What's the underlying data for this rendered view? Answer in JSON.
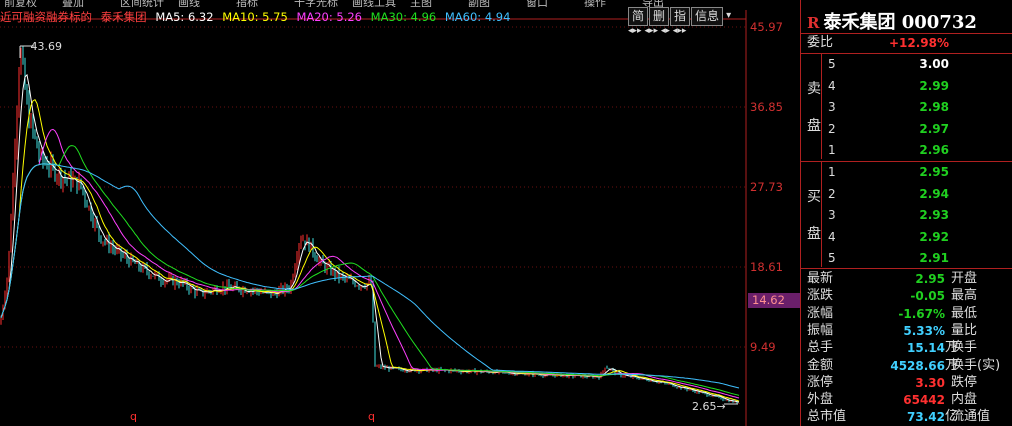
{
  "menu": [
    "前复权",
    "叠加",
    "区间统计",
    "画线",
    "指标",
    "十字光标",
    "画线工具",
    "主图",
    "副图",
    "窗口",
    "操作",
    "导出"
  ],
  "info_bar": {
    "prefix": "近可融资融券标的",
    "name": "泰禾集团",
    "ma5": "MA5: 6.32",
    "ma10": "MA10: 5.75",
    "ma20": "MA20: 5.26",
    "ma30": "MA30: 4.96",
    "ma60": "MA60: 4.94"
  },
  "toolbar": {
    "jian": "简",
    "shan": "删",
    "zhi": "指",
    "xinxi": "信息",
    "arrow": "▾"
  },
  "axis": {
    "labels": [
      "45.97",
      "36.85",
      "27.73",
      "18.61",
      "9.49"
    ],
    "current": "14.62"
  },
  "chart": {
    "high_label": "43.69",
    "low_label": "2.65",
    "q_marker": "q"
  },
  "colors": {
    "up": "#ff3030",
    "down": "#20d020",
    "ma5": "#ffffff",
    "ma10": "#ffff00",
    "ma20": "#ff40ff",
    "ma30": "#20e020",
    "ma60": "#40c0ff"
  },
  "panel": {
    "title": "泰禾集团",
    "code": "000732",
    "weibi_label": "委比",
    "weibi_value": "+12.98%",
    "sell_label": [
      "卖",
      "盘"
    ],
    "buy_label": [
      "买",
      "盘"
    ],
    "asks": [
      {
        "level": "5",
        "price": "3.00"
      },
      {
        "level": "4",
        "price": "2.99"
      },
      {
        "level": "3",
        "price": "2.98"
      },
      {
        "level": "2",
        "price": "2.97"
      },
      {
        "level": "1",
        "price": "2.96"
      }
    ],
    "bids": [
      {
        "level": "1",
        "price": "2.95"
      },
      {
        "level": "2",
        "price": "2.94"
      },
      {
        "level": "3",
        "price": "2.93"
      },
      {
        "level": "4",
        "price": "2.92"
      },
      {
        "level": "5",
        "price": "2.91"
      }
    ],
    "stats": [
      {
        "label": "最新",
        "value": "2.95",
        "unit": "",
        "label2": "开盘",
        "color": "#20d020"
      },
      {
        "label": "涨跌",
        "value": "-0.05",
        "unit": "",
        "label2": "最高",
        "color": "#20d020"
      },
      {
        "label": "涨幅",
        "value": "-1.67%",
        "unit": "",
        "label2": "最低",
        "color": "#20d020"
      },
      {
        "label": "振幅",
        "value": "5.33%",
        "unit": "",
        "label2": "量比",
        "color": "#40d0ff"
      },
      {
        "label": "总手",
        "value": "15.14",
        "unit": "万",
        "label2": "换手",
        "color": "#40d0ff"
      },
      {
        "label": "金额",
        "value": "4528.66",
        "unit": "万",
        "label2": "换手(实)",
        "color": "#40d0ff"
      },
      {
        "label": "涨停",
        "value": "3.30",
        "unit": "",
        "label2": "跌停",
        "color": "#ff3030"
      },
      {
        "label": "外盘",
        "value": "65442",
        "unit": "",
        "label2": "内盘",
        "color": "#ff3030"
      },
      {
        "label": "总市值",
        "value": "73.42",
        "unit": "亿",
        "label2": "流通值",
        "color": "#40d0ff"
      }
    ]
  }
}
